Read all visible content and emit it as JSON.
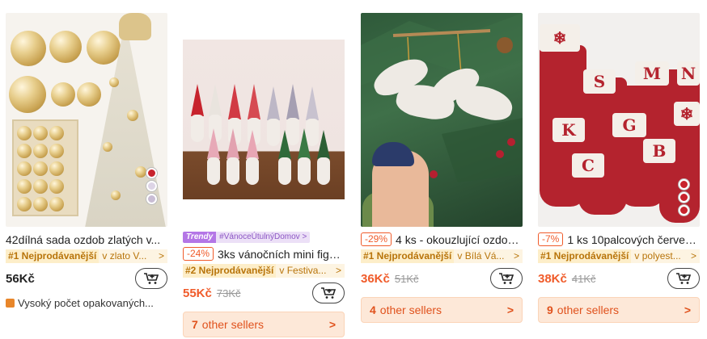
{
  "products": [
    {
      "title": "42dílná sada ozdob zlatých v...",
      "rank_badge": "#1 Nejprodávanější",
      "rank_category": "v zlato V...",
      "rank_arrow": ">",
      "price": "56Kč",
      "repeat_text": "Vysoký počet opakovaných..."
    },
    {
      "trendy_badge": "Trendy",
      "trendy_tag": "#VánoceÚtulnýDomov >",
      "discount": "-24%",
      "title": "3ks vánočních mini figu...",
      "rank_badge": "#2 Nejprodávanější",
      "rank_category": "v Festiva...",
      "rank_arrow": ">",
      "price": "55Kč",
      "old_price": "73Kč",
      "sellers_count": "7",
      "sellers_label": "other sellers",
      "sellers_arrow": ">"
    },
    {
      "discount": "-29%",
      "title": "4 ks - okouzlující ozdob...",
      "rank_badge": "#1 Nejprodávanější",
      "rank_category": "v Bílá Vá...",
      "rank_arrow": ">",
      "price": "36Kč",
      "old_price": "51Kč",
      "sellers_count": "4",
      "sellers_label": "other sellers",
      "sellers_arrow": ">"
    },
    {
      "discount": "-7%",
      "title": "1 ks 10palcových červen...",
      "rank_badge": "#1 Nejprodávanější",
      "rank_category": "v polyest...",
      "rank_arrow": ">",
      "price": "38Kč",
      "old_price": "41Kč",
      "sellers_count": "9",
      "sellers_label": "other sellers",
      "sellers_arrow": ">",
      "stocking_letters": [
        "S",
        "M",
        "N",
        "K",
        "G",
        "B",
        "C"
      ]
    }
  ],
  "colors": {
    "accent": "#f05b2a",
    "rank_text": "#b8740a",
    "trendy": "#b476e6",
    "sellers_bg": "#fde8d8"
  },
  "icons": {
    "cart": "add-to-cart-icon",
    "repeat": "repeat-purchase-icon",
    "chevron": "chevron-right-icon"
  }
}
